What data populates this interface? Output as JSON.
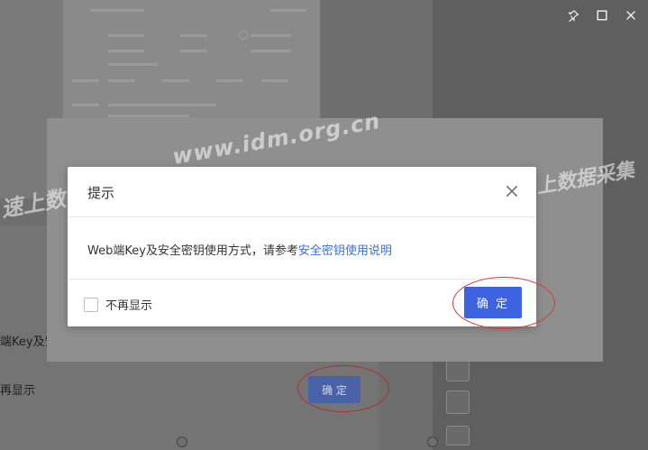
{
  "window_controls": {
    "pin": "pin-icon",
    "maximize": "maximize-icon",
    "close": "close-icon"
  },
  "watermark": {
    "text_left": "速上数据采集",
    "text_url": "www.idm.org.cn",
    "text_right": "上数据采集"
  },
  "background": {
    "bg_text_1": "端Key及安",
    "bg_text_2": "再显示",
    "bg_confirm": "确 定"
  },
  "dialog": {
    "title": "提示",
    "message_prefix": "Web端Key及安全密钥使用方式，请参考",
    "message_link": "安全密钥使用说明",
    "dont_show_label": "不再显示",
    "confirm_label": "确 定"
  },
  "colors": {
    "primary": "#3e63e0",
    "link": "#3b6fd6",
    "annotation": "#d53a3a"
  }
}
